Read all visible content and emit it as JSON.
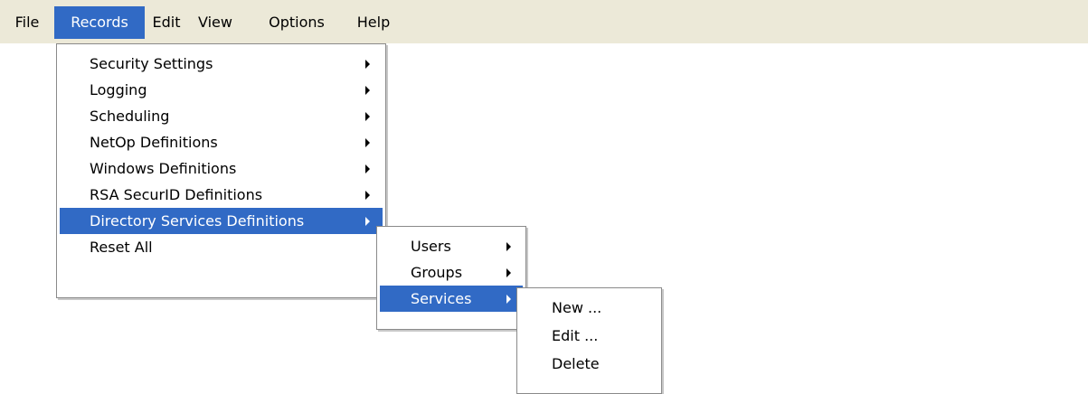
{
  "menubar": {
    "items": [
      "File",
      "Records",
      "Edit",
      "View",
      "Options",
      "Help"
    ],
    "active": "Records"
  },
  "records_menu": {
    "items": [
      {
        "label": "Security Settings",
        "submenu": true
      },
      {
        "label": "Logging",
        "submenu": true
      },
      {
        "label": "Scheduling",
        "submenu": true
      },
      {
        "label": "NetOp Definitions",
        "submenu": true
      },
      {
        "label": "Windows Definitions",
        "submenu": true
      },
      {
        "label": "RSA SecurID Definitions",
        "submenu": true
      },
      {
        "label": "Directory Services Definitions",
        "submenu": true,
        "highlighted": true
      },
      {
        "label": "Reset All",
        "submenu": false
      }
    ]
  },
  "directory_services_submenu": {
    "items": [
      {
        "label": "Users",
        "submenu": true
      },
      {
        "label": "Groups",
        "submenu": true
      },
      {
        "label": "Services",
        "submenu": true,
        "highlighted": true
      }
    ]
  },
  "services_submenu": {
    "items": [
      {
        "label": "New ..."
      },
      {
        "label": "Edit ..."
      },
      {
        "label": "Delete"
      }
    ]
  },
  "colors": {
    "menubar_bg": "#ece9d8",
    "highlight": "#316ac5",
    "menu_border": "#8a8a8a"
  }
}
